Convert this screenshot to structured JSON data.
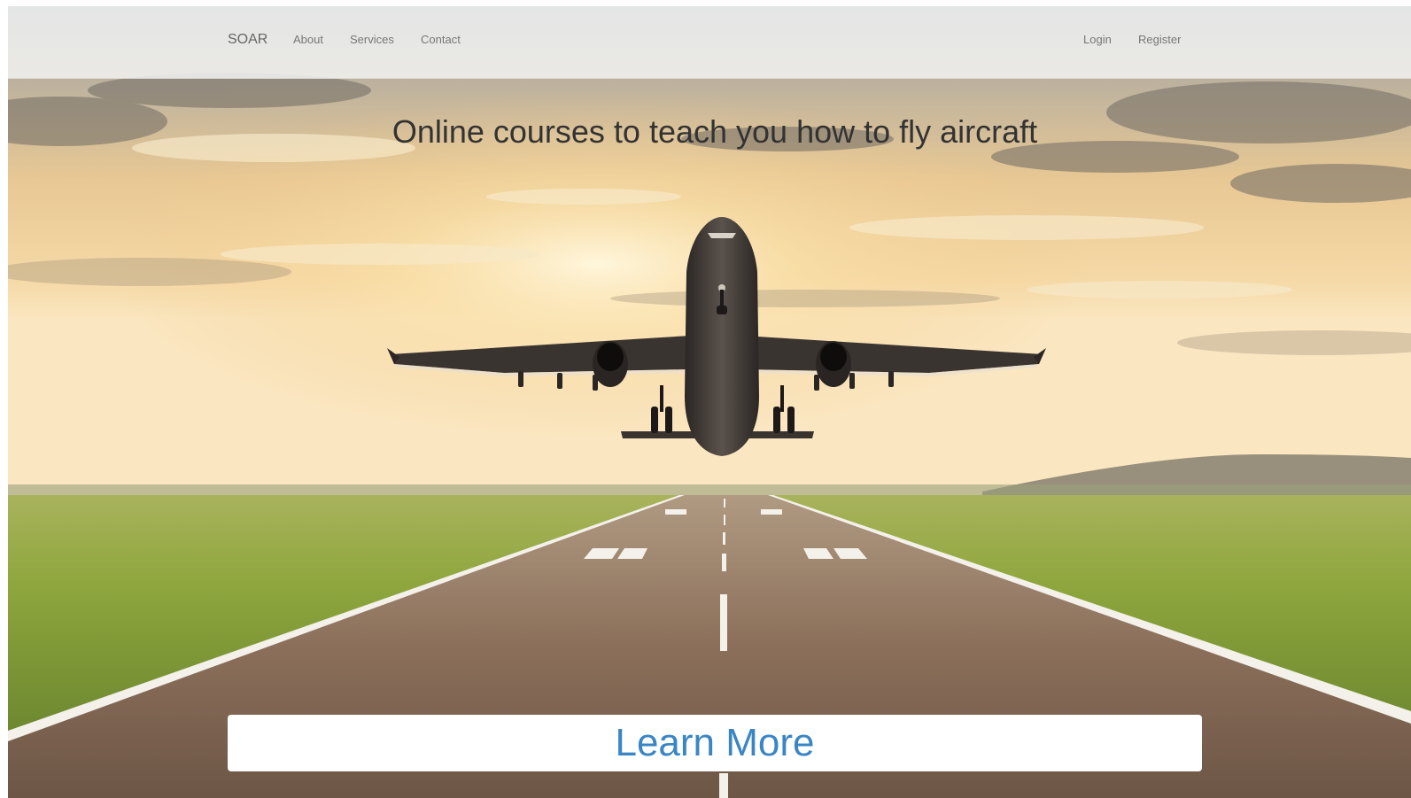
{
  "nav": {
    "brand": "SOAR",
    "links": [
      "About",
      "Services",
      "Contact"
    ],
    "right_links": [
      "Login",
      "Register"
    ]
  },
  "hero": {
    "title": "Online courses to teach you how to fly aircraft",
    "cta_label": "Learn More"
  },
  "icons": [
    "airplane-icon"
  ],
  "colors": {
    "cta_text": "#3a86c4",
    "title_text": "#333333",
    "nav_text": "#777777"
  }
}
